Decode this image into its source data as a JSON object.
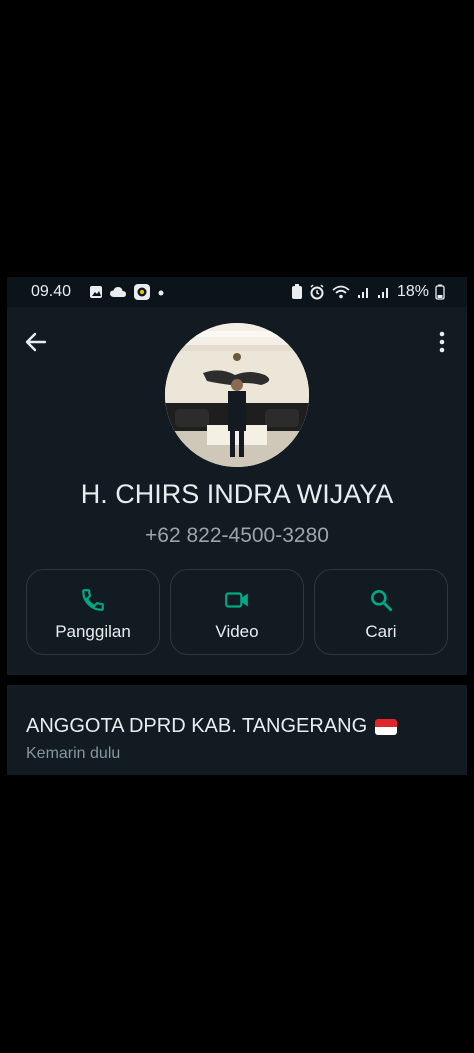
{
  "status_bar": {
    "time": "09.40",
    "battery": "18%"
  },
  "contact": {
    "name": "H. CHIRS INDRA WIJAYA",
    "phone": "+62 822-4500-3280"
  },
  "actions": [
    {
      "label": "Panggilan",
      "icon": "phone-icon"
    },
    {
      "label": "Video",
      "icon": "video-icon"
    },
    {
      "label": "Cari",
      "icon": "search-icon"
    }
  ],
  "about": {
    "text": "ANGGOTA DPRD KAB. TANGERANG",
    "date": "Kemarin dulu"
  },
  "colors": {
    "accent": "#00a884",
    "card_bg": "#111b21",
    "muted_text": "#8696a0"
  }
}
